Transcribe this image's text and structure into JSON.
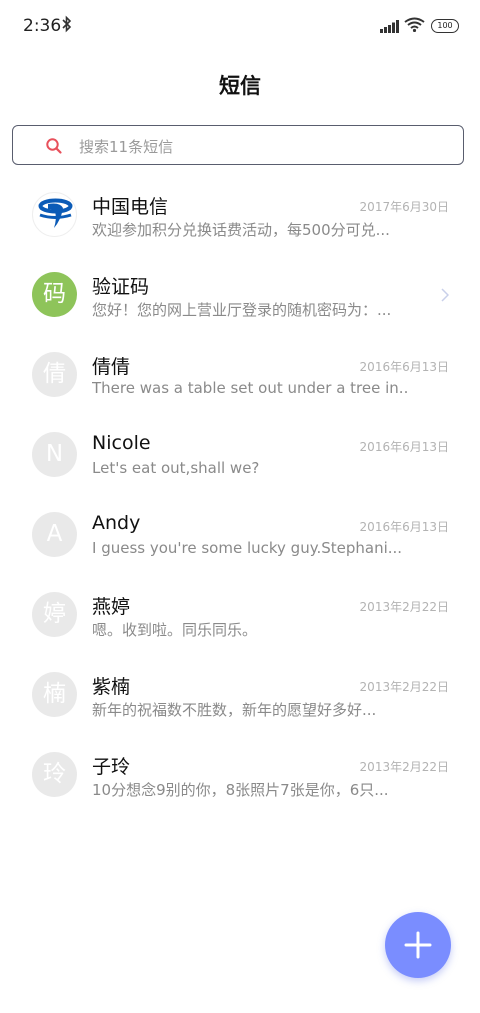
{
  "status_bar": {
    "time": "2:36",
    "battery": "100",
    "icons": [
      "bluetooth-icon",
      "signal-icon",
      "wifi-icon",
      "battery-icon"
    ]
  },
  "header": {
    "title": "短信"
  },
  "search": {
    "placeholder": "搜索11条短信"
  },
  "conversations": [
    {
      "name": "中国电信",
      "date": "2017年6月30日",
      "preview": "欢迎参加积分兑换话费活动，每500分可兑...",
      "avatar": "",
      "avatar_type": "logo"
    },
    {
      "name": "验证码",
      "date": "",
      "preview": "您好！您的网上营业厅登录的随机密码为：...",
      "avatar": "码",
      "avatar_type": "green"
    },
    {
      "name": "倩倩",
      "date": "2016年6月13日",
      "preview": "There was a table set out under a tree in...",
      "avatar": "倩",
      "avatar_type": "gray"
    },
    {
      "name": "Nicole",
      "date": "2016年6月13日",
      "preview": "Let's eat out,shall we?",
      "avatar": "N",
      "avatar_type": "gray"
    },
    {
      "name": "Andy",
      "date": "2016年6月13日",
      "preview": "I guess you're some lucky guy.Stephani...",
      "avatar": "A",
      "avatar_type": "gray"
    },
    {
      "name": "燕婷",
      "date": "2013年2月22日",
      "preview": "嗯。收到啦。同乐同乐。",
      "avatar": "婷",
      "avatar_type": "gray"
    },
    {
      "name": "紫楠",
      "date": "2013年2月22日",
      "preview": "新年的祝福数不胜数，新年的愿望好多好...",
      "avatar": "楠",
      "avatar_type": "gray"
    },
    {
      "name": "子玲",
      "date": "2013年2月22日",
      "preview": "10分想念9别的你，8张照片7张是你，6只...",
      "avatar": "玲",
      "avatar_type": "gray"
    }
  ],
  "colors": {
    "accent": "#7a8dff",
    "search_icon": "#e8505b",
    "green_avatar": "#8ec45a",
    "gray_avatar": "#e9e9e9",
    "telecom_blue": "#0b5bb7"
  },
  "fab": {
    "icon": "plus-icon"
  }
}
